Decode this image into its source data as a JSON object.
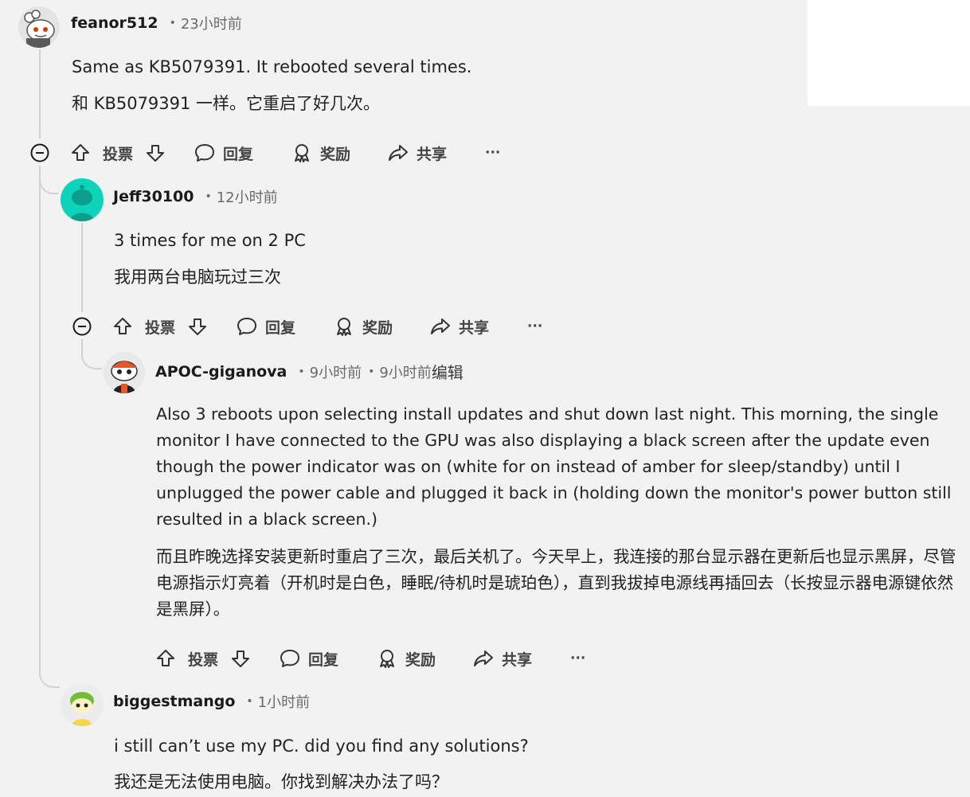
{
  "comments": [
    {
      "author": "feanor512",
      "time": "23小时前",
      "lines": [
        "Same as KB5079391. It rebooted several times.",
        "和 KB5079391 一样。它重启了好几次。"
      ]
    },
    {
      "author": "Jeff30100",
      "time": "12小时前",
      "lines": [
        "3 times for me on 2 PC",
        "我用两台电脑玩过三次"
      ]
    },
    {
      "author": "APOC-giganova",
      "time": "9小时前",
      "edited_time": "9小时前",
      "edited_label": "编辑",
      "lines": [
        "Also 3 reboots upon selecting install updates and shut down last night. This morning, the single monitor I have connected to the GPU was also displaying a black screen after the update even though the power indicator was on (white for on instead of amber for sleep/standby) until I unplugged the power cable and plugged it back in (holding down the monitor's power button still resulted in a black screen.)",
        "而且昨晚选择安装更新时重启了三次，最后关机了。今天早上，我连接的那台显示器在更新后也显示黑屏，尽管电源指示灯亮着（开机时是白色，睡眠/待机时是琥珀色），直到我拔掉电源线再插回去（长按显示器电源键依然是黑屏）。"
      ]
    },
    {
      "author": "biggestmango",
      "time": "1小时前",
      "lines": [
        "i still can’t use my PC. did you find any solutions?",
        "我还是无法使用电脑。你找到解决办法了吗？"
      ]
    }
  ],
  "actions": {
    "vote": "投票",
    "reply": "回复",
    "award": "奖励",
    "share": "共享",
    "more": "···"
  },
  "colors": {
    "background": "#f2f2f2",
    "meta_gray": "#6a6a6a",
    "jeff_avatar": "#0dd3bb",
    "thread_line": "#d2d2d2"
  }
}
